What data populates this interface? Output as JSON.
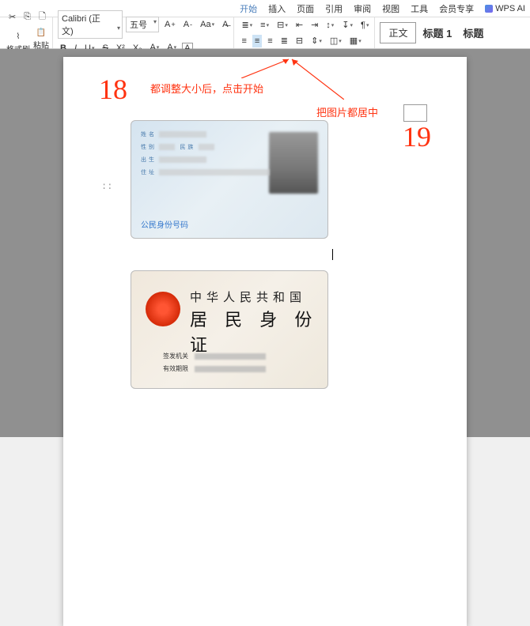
{
  "menubar": {
    "items": [
      "开始",
      "插入",
      "页面",
      "引用",
      "审阅",
      "视图",
      "工具",
      "会员专享"
    ],
    "active": 0,
    "wpsai": "WPS AI"
  },
  "toolbar": {
    "format_painter": "格式刷",
    "paste": "粘贴",
    "font_name": "Calibri (正文)",
    "font_size": "五号",
    "style_box": "正文",
    "heading1": "标题 1",
    "heading_more": "标题"
  },
  "annotations": {
    "n18": "18",
    "txt1": "都调整大小后，点击开始",
    "txt2": "把图片都居中",
    "n19": "19"
  },
  "id_front": {
    "name_label": "姓 名",
    "sex_label": "性 别",
    "nation_label": "民 族",
    "birth_label": "出 生",
    "addr_label": "住 址",
    "num_label": "公民身份号码"
  },
  "id_back": {
    "line1": "中华人民共和国",
    "line2": "居 民 身 份 证",
    "issuer_label": "签发机关",
    "valid_label": "有效期限"
  }
}
